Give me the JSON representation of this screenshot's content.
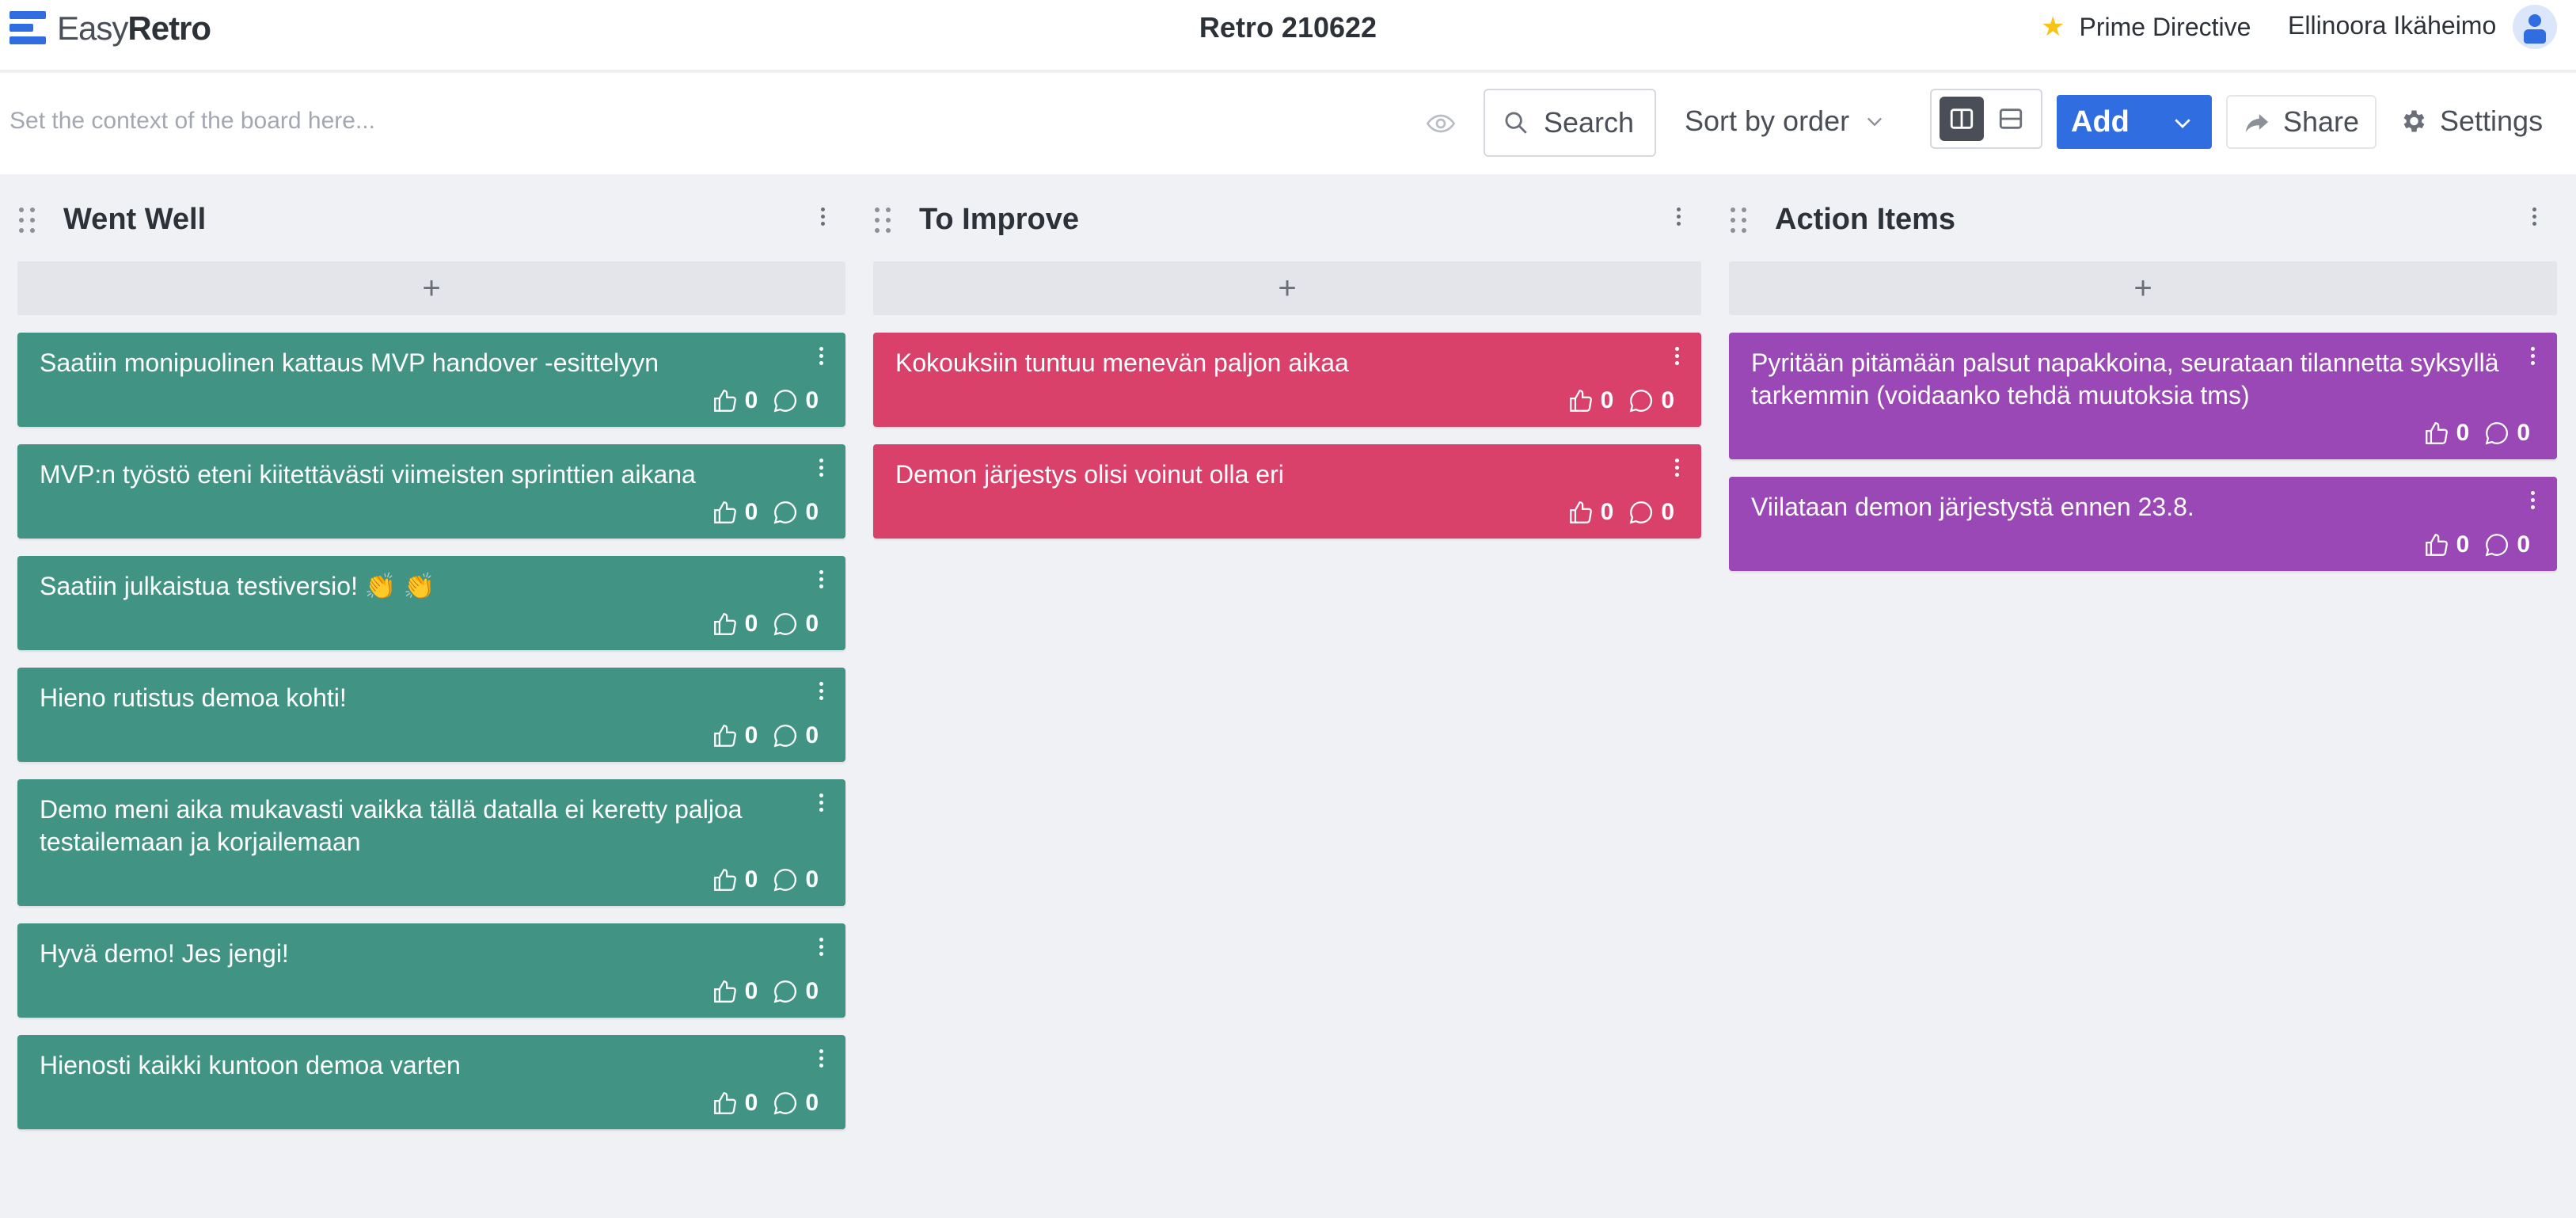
{
  "header": {
    "logo_light": "Easy",
    "logo_bold": "Retro",
    "board_title": "Retro 210622",
    "prime_directive_label": "Prime Directive",
    "user_name": "Ellinoora Ikäheimo"
  },
  "toolbar": {
    "context_placeholder": "Set the context of the board here...",
    "search_label": "Search",
    "sort_label": "Sort by order",
    "add_label": "Add",
    "share_label": "Share",
    "settings_label": "Settings"
  },
  "columns": [
    {
      "title": "Went Well",
      "color": "#419484",
      "cards": [
        {
          "text": "Saatiin monipuolinen kattaus MVP handover -esittelyyn",
          "likes": "0",
          "comments": "0"
        },
        {
          "text": "MVP:n työstö eteni kiitettävästi viimeisten sprinttien aikana",
          "likes": "0",
          "comments": "0"
        },
        {
          "text": "Saatiin julkaistua testiversio! 👏 👏",
          "likes": "0",
          "comments": "0"
        },
        {
          "text": "Hieno rutistus demoa kohti!",
          "likes": "0",
          "comments": "0"
        },
        {
          "text": "Demo meni aika mukavasti vaikka tällä datalla ei keretty paljoa testailemaan ja korjailemaan",
          "likes": "0",
          "comments": "0"
        },
        {
          "text": "Hyvä demo! Jes jengi!",
          "likes": "0",
          "comments": "0"
        },
        {
          "text": "Hienosti kaikki kuntoon demoa varten",
          "likes": "0",
          "comments": "0"
        }
      ]
    },
    {
      "title": "To Improve",
      "color": "#d9406a",
      "cards": [
        {
          "text": "Kokouksiin tuntuu menevän paljon aikaa",
          "likes": "0",
          "comments": "0"
        },
        {
          "text": "Demon järjestys olisi voinut olla eri",
          "likes": "0",
          "comments": "0"
        }
      ]
    },
    {
      "title": "Action Items",
      "color": "#9a48b5",
      "cards": [
        {
          "text": "Pyritään pitämään palsut napakkoina, seurataan tilannetta syksyllä tarkemmin (voidaanko tehdä muutoksia tms)",
          "likes": "0",
          "comments": "0"
        },
        {
          "text": "Viilataan demon järjestystä ennen 23.8.",
          "likes": "0",
          "comments": "0"
        }
      ]
    }
  ],
  "icons": {
    "add_card": "+",
    "star": "star-icon"
  }
}
